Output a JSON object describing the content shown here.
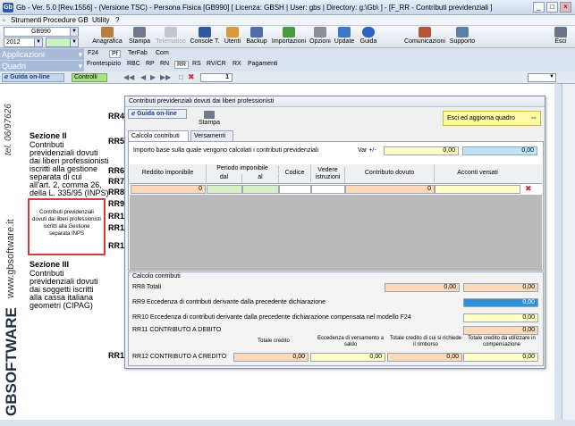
{
  "window": {
    "title": "Gb - Ver. 5.0 [Rev.1556] - (Versione TSC) - Persona Fisica [GB990]   [ Licenza: GBSH | User: gbs | Directory: g:\\Gb\\ ] - [F_RR - Contributi previdenziali ]",
    "app_icon": "Gb",
    "controls": [
      "_",
      "□",
      "×"
    ]
  },
  "menu": [
    "Strumenti",
    "Procedure GB",
    "Utility",
    "?"
  ],
  "selectors": {
    "model": "GB990",
    "year": "2012",
    "applicazioni": "Applicazioni",
    "quadri": "Quadri"
  },
  "toolbar": [
    {
      "label": "Anagrafica",
      "icon": "anagrafica-icon"
    },
    {
      "label": "Stampa",
      "icon": "printer-icon"
    },
    {
      "label": "Telematico",
      "icon": "telematico-icon",
      "disabled": true
    },
    {
      "label": "Console T.",
      "icon": "console-icon"
    },
    {
      "label": "Utenti",
      "icon": "users-icon"
    },
    {
      "label": "Backup",
      "icon": "backup-icon"
    },
    {
      "label": "Importazioni",
      "icon": "import-icon"
    },
    {
      "label": "Opzioni",
      "icon": "options-icon"
    },
    {
      "label": "Update",
      "icon": "update-icon"
    },
    {
      "label": "Guida",
      "icon": "help-icon"
    },
    {
      "label": "Comunicazioni",
      "icon": "comunicazioni-icon"
    },
    {
      "label": "Supporto",
      "icon": "supporto-icon"
    },
    {
      "label": "Esci",
      "icon": "exit-icon"
    }
  ],
  "quadri_tabs_row1": [
    "F24",
    "Pf",
    "TerFab",
    "Com"
  ],
  "quadri_tabs_row2": [
    "Frontespizio",
    "RBC",
    "RP",
    "RN",
    "RR",
    "RS",
    "RV/CR",
    "RX",
    "Pagamenti"
  ],
  "nav": {
    "guida": "Guida on-line",
    "controlli": "Controlli",
    "page": "1"
  },
  "brand": {
    "phone": "tel. 06/97626",
    "site": "www.gbsoftware.it",
    "logo": "GBSOFTWARE"
  },
  "doc": {
    "sez2_title": "Sezione II",
    "sez2_body": [
      "Contributi",
      "previdenziali dovuti",
      "dai liberi professionisti",
      "iscritti alla gestione",
      "separata di cui",
      "all'art. 2, comma 26,",
      "della L. 335/95 (INPS)"
    ],
    "redbox": "Contributi previdenziali dovuti dai liberi professionisti iscritti alla Gestione separata INPS",
    "sez3_title": "Sezione III",
    "sez3_body": [
      "Contributi",
      "previdenziali dovuti",
      "dai soggetti iscritti",
      "alla cassa italiana",
      "geometri (CIPAG)"
    ],
    "codes": [
      "RR4",
      "RR5",
      "RR6",
      "RR7",
      "RR8",
      "RR9",
      "RR1",
      "RR1",
      "RR1",
      "RR1"
    ]
  },
  "dialog": {
    "title": "Contributi previdenziali dovuti dai liberi professionisti",
    "guida": "Guida on-line",
    "stampa": "Stampa",
    "esci": "Esci ed aggiorna quadro",
    "tabs": [
      "Calcolo contributi",
      "Versamenti"
    ],
    "importo_label": "Importo base sulla quale vengono calcolati i contributi previdenziali",
    "var_label": "Var +/-",
    "var_value": "0,00",
    "importo_value": "0,00",
    "grid_headers": {
      "reddito": "Reddito imponibile",
      "periodo": "Periodo imponibile",
      "dal": "dal",
      "al": "al",
      "codice": "Codice",
      "vedere": "Vedere istruzioni",
      "dovuto": "Contributo dovuto",
      "acconti": "Acconti versati"
    },
    "grid_row": {
      "reddito": "0",
      "dovuto": "0"
    },
    "calc_title": "Calcolo contributi",
    "rr8": {
      "label": "RR8 Totali",
      "a": "0,00",
      "b": "0,00"
    },
    "rr9": {
      "label": "RR9 Eccedenza di contributi derivante dalla precedente dichiarazione",
      "value": "0,00"
    },
    "rr10": {
      "label": "RR10 Eccedenza di contributi derivante dalla precedente dichiarazione compensata nel modello F24",
      "value": "0,00"
    },
    "rr11": {
      "label": "RR11 CONTRIBUTO A DEBITO",
      "value": "0,00"
    },
    "rr12_headers": [
      "Totale credito",
      "Eccedenza di versamento a saldo",
      "Totale credito di cui si richiede il rimborso",
      "Totale credito da utilizzare in compensazione"
    ],
    "rr12": {
      "label": "RR12 CONTRIBUTO A CREDITO",
      "values": [
        "0,00",
        "0,00",
        "0,00",
        "0,00"
      ]
    }
  }
}
